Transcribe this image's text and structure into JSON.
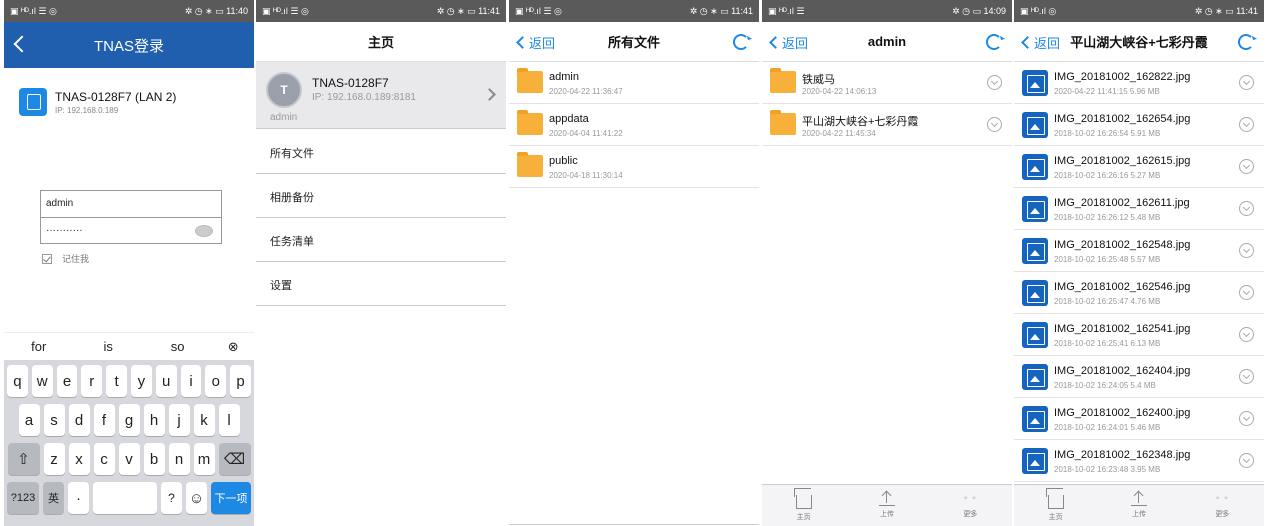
{
  "s1": {
    "status_left": "▣ ᴴᴰ.ıl ☰ ◎",
    "status_right": "✲ ◷ ∗ ▭ 11:40",
    "title": "TNAS登录",
    "device_name": "TNAS-0128F7 (LAN 2)",
    "device_ip": "IP: 192.168.0.189",
    "username": "admin",
    "password": "···········",
    "remember": "记住我",
    "suggestions": [
      "for",
      "is",
      "so"
    ],
    "clear_symbol": "⊗",
    "row1": [
      "q",
      "w",
      "e",
      "r",
      "t",
      "y",
      "u",
      "i",
      "o",
      "p"
    ],
    "row2": [
      "a",
      "s",
      "d",
      "f",
      "g",
      "h",
      "j",
      "k",
      "l"
    ],
    "row3": [
      "z",
      "x",
      "c",
      "v",
      "b",
      "n",
      "m"
    ],
    "shift": "⇧",
    "backspace": "⌫",
    "key_123": "?123",
    "key_lang": "英",
    "key_dot": "·",
    "key_q": "?",
    "key_emoji": "☺",
    "key_next": "下一项"
  },
  "s2": {
    "status_left": "▣ ᴴᴰ.ıl ☰ ◎",
    "status_right": "✲ ◷ ∗ ▭ 11:41",
    "title": "主页",
    "avatar": "T",
    "device_name": "TNAS-0128F7",
    "device_ip": "IP: 192.168.0.189:8181",
    "user": "admin",
    "menu": [
      "所有文件",
      "相册备份",
      "任务清单",
      "设置"
    ]
  },
  "s3": {
    "status_left": "▣ ᴴᴰ.ıl ☰ ◎",
    "status_right": "✲ ◷ ∗ ▭ 11:41",
    "back": "返回",
    "title": "所有文件",
    "folders": [
      {
        "name": "admin",
        "date": "2020-04-22 11:36:47"
      },
      {
        "name": "appdata",
        "date": "2020-04-04 11:41:22"
      },
      {
        "name": "public",
        "date": "2020-04-18 11:30:14"
      }
    ]
  },
  "s4": {
    "status_left": "▣ ᴴᴰ.ıl ☰",
    "status_right": "✲ ◷ ▭ 14:09",
    "back": "返回",
    "title": "admin",
    "folders": [
      {
        "name": "铁威马",
        "date": "2020-04-22 14:06:13"
      },
      {
        "name": "平山湖大峡谷+七彩丹霞",
        "date": "2020-04-22 11:45:34"
      }
    ],
    "toolbar": [
      "主页",
      "上传",
      "更多"
    ],
    "more_dots": "◦ ◦ ◦"
  },
  "s5": {
    "status_left": "▣ ᴴᴰ.ıl ◎",
    "status_right": "✲ ◷ ∗ ▭ 11:41",
    "back": "返回",
    "title": "平山湖大峡谷+七彩丹霞",
    "files": [
      {
        "name": "IMG_20181002_162822.jpg",
        "meta": "2020-04-22 11:41:15 5.96 MB"
      },
      {
        "name": "IMG_20181002_162654.jpg",
        "meta": "2018-10-02 16:26:54 5.91 MB"
      },
      {
        "name": "IMG_20181002_162615.jpg",
        "meta": "2018-10-02 16:26:16 5.27 MB"
      },
      {
        "name": "IMG_20181002_162611.jpg",
        "meta": "2018-10-02 16:26:12 5.48 MB"
      },
      {
        "name": "IMG_20181002_162548.jpg",
        "meta": "2018-10-02 16:25:48 5.57 MB"
      },
      {
        "name": "IMG_20181002_162546.jpg",
        "meta": "2018-10-02 16:25:47 4.76 MB"
      },
      {
        "name": "IMG_20181002_162541.jpg",
        "meta": "2018-10-02 16:25:41 6.13 MB"
      },
      {
        "name": "IMG_20181002_162404.jpg",
        "meta": "2018-10-02 16:24:05 5.4 MB"
      },
      {
        "name": "IMG_20181002_162400.jpg",
        "meta": "2018-10-02 16:24:01 5.46 MB"
      },
      {
        "name": "IMG_20181002_162348.jpg",
        "meta": "2018-10-02 16:23:48 3.95 MB"
      }
    ],
    "toolbar": [
      "主页",
      "上传",
      "更多"
    ],
    "more_dots": "◦ ◦ ◦"
  }
}
